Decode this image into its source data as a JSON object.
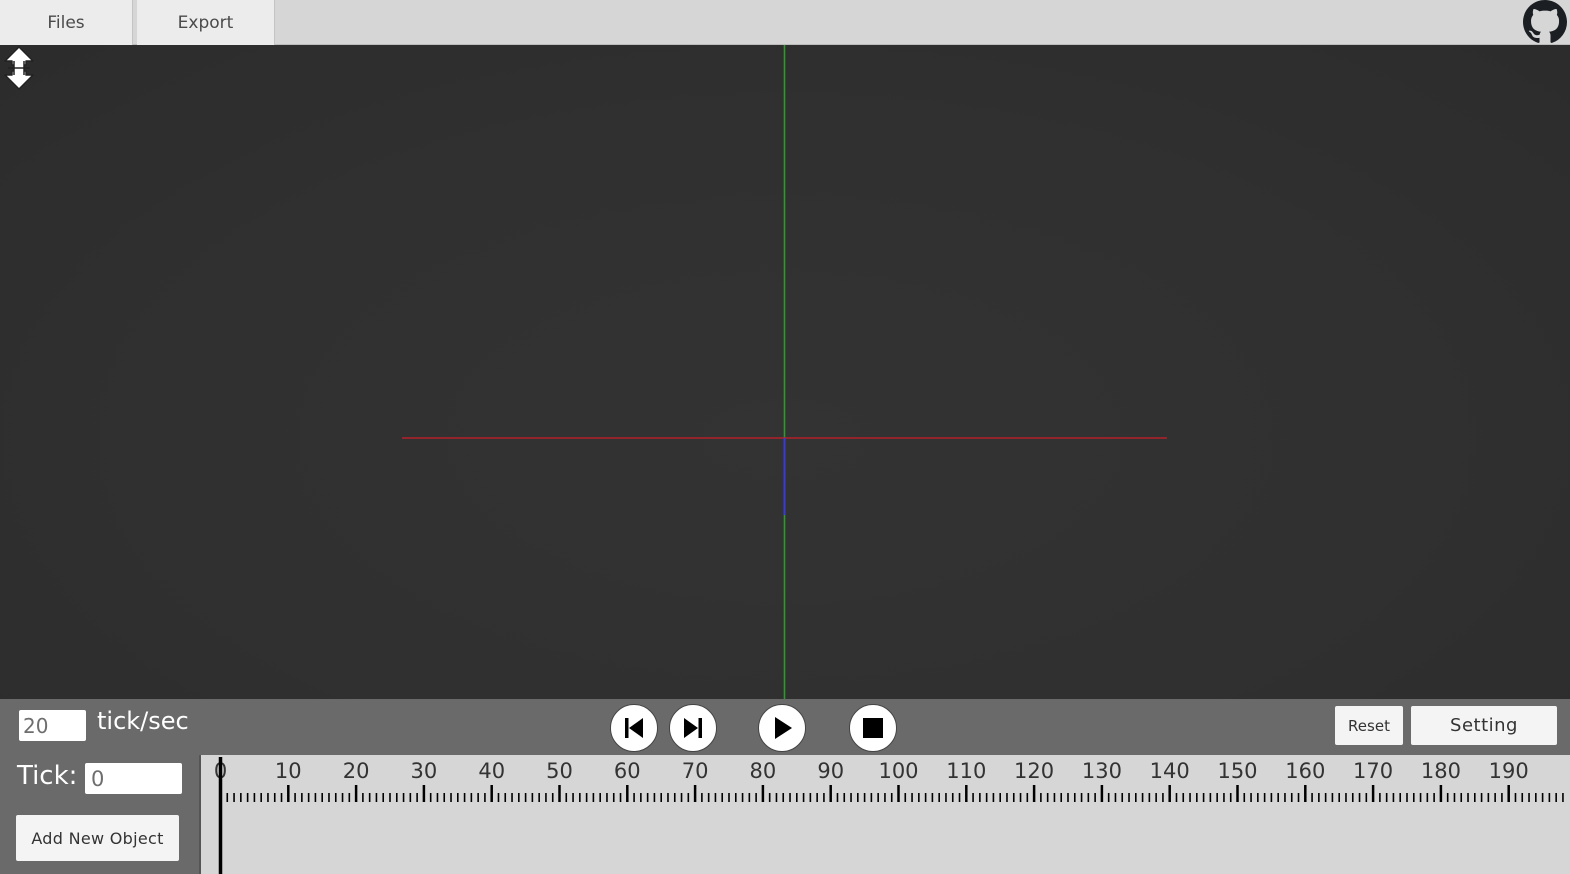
{
  "menu": {
    "files_label": "Files",
    "export_label": "Export",
    "github_icon": "github-icon"
  },
  "viewport": {
    "axis_colors": {
      "x": "#b4202a",
      "y": "#2e9a2e",
      "z": "#3a3ad8"
    },
    "collapse_icon": "collapse-vertical-icon"
  },
  "controls": {
    "tps_value": "20",
    "tps_label": "tick/sec",
    "prev_icon": "skip-back-icon",
    "next_icon": "skip-forward-icon",
    "play_icon": "play-icon",
    "stop_icon": "stop-icon",
    "reset_label": "Reset",
    "setting_label": "Setting"
  },
  "timeline": {
    "tick_label": "Tick:",
    "tick_value": "0",
    "add_object_label": "Add New Object",
    "labels": [
      "0",
      "10",
      "20",
      "30",
      "40",
      "50",
      "60",
      "70",
      "80",
      "90",
      "100",
      "110",
      "120",
      "130",
      "140",
      "150",
      "160",
      "170",
      "180",
      "190"
    ],
    "current_tick": 0
  }
}
